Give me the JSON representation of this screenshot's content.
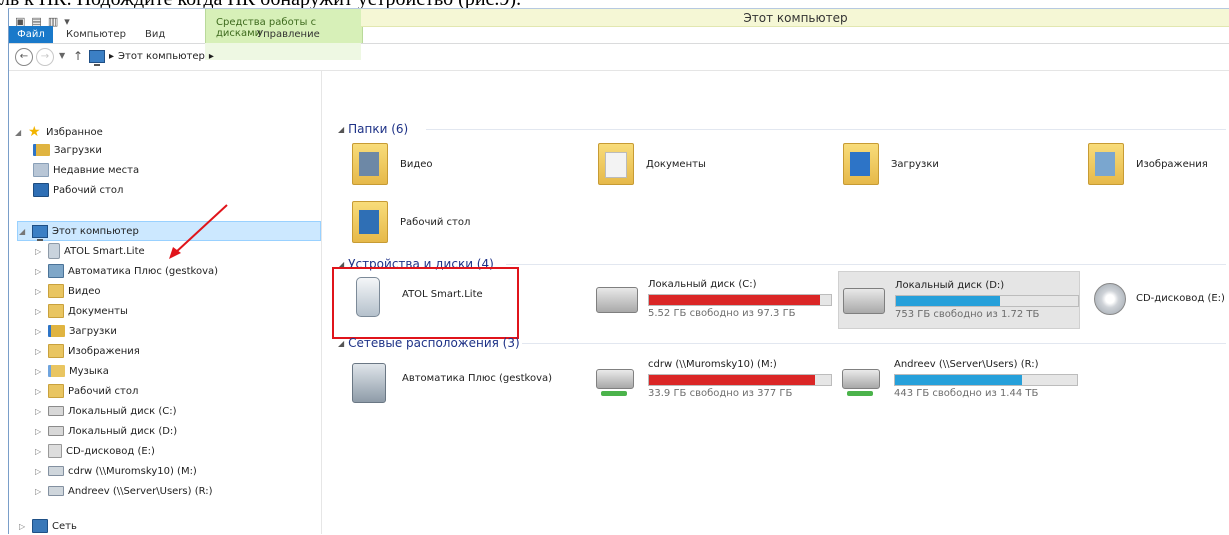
{
  "doc_fragment": "ль к ПК. Подождите когда ПК обнаружит устройство (рис.9).",
  "window": {
    "title": "Этот компьютер",
    "contextual_group": "Средства работы с дисками"
  },
  "ribbon": {
    "tabs": [
      "Файл",
      "Компьютер",
      "Вид",
      "Управление"
    ]
  },
  "address": {
    "path": [
      "Этот компьютер"
    ]
  },
  "navigation": {
    "favorites_label": "Избранное",
    "favorites": [
      {
        "label": "Загрузки",
        "icon": "downloads-folder-icon"
      },
      {
        "label": "Недавние места",
        "icon": "recent-places-icon"
      },
      {
        "label": "Рабочий стол",
        "icon": "desktop-icon"
      }
    ],
    "computer_label": "Этот компьютер",
    "computer_items": [
      {
        "label": "ATOL Smart.Lite",
        "icon": "phone-icon"
      },
      {
        "label": "Автоматика Плюс (gestkova)",
        "icon": "network-location-icon"
      },
      {
        "label": "Видео",
        "icon": "video-folder-icon"
      },
      {
        "label": "Документы",
        "icon": "documents-folder-icon"
      },
      {
        "label": "Загрузки",
        "icon": "downloads-folder-icon"
      },
      {
        "label": "Изображения",
        "icon": "pictures-folder-icon"
      },
      {
        "label": "Музыка",
        "icon": "music-folder-icon"
      },
      {
        "label": "Рабочий стол",
        "icon": "desktop-folder-icon"
      },
      {
        "label": "Локальный диск (C:)",
        "icon": "drive-icon"
      },
      {
        "label": "Локальный диск (D:)",
        "icon": "drive-icon"
      },
      {
        "label": "CD-дисковод (E:)",
        "icon": "cd-drive-icon"
      },
      {
        "label": "cdrw (\\\\Muromsky10) (M:)",
        "icon": "network-drive-icon"
      },
      {
        "label": "Andreev (\\\\Server\\Users) (R:)",
        "icon": "network-drive-icon"
      }
    ],
    "network_label": "Сеть"
  },
  "content": {
    "folders_header": "Папки (6)",
    "folders": [
      "Видео",
      "Документы",
      "Загрузки",
      "Изображения",
      "Рабочий стол"
    ],
    "devices_header": "Устройства и диски (4)",
    "devices": [
      {
        "name": "ATOL Smart.Lite",
        "kind": "portable-device"
      },
      {
        "name": "Локальный диск (C:)",
        "free": "5.52 ГБ свободно из 97.3 ГБ",
        "used_fraction": 0.94,
        "bar_color": "#da2626"
      },
      {
        "name": "Локальный диск (D:)",
        "free": "753 ГБ свободно из 1.72 ТБ",
        "used_fraction": 0.57,
        "bar_color": "#26a0da"
      },
      {
        "name": "CD-дисковод (E:)",
        "kind": "cd"
      }
    ],
    "network_header": "Сетевые расположения (3)",
    "network": [
      {
        "name": "Автоматика Плюс (gestkova)",
        "kind": "location"
      },
      {
        "name": "cdrw (\\\\Muromsky10) (M:)",
        "free": "33.9 ГБ свободно из 377 ГБ",
        "used_fraction": 0.91,
        "bar_color": "#da2626"
      },
      {
        "name": "Andreev (\\\\Server\\Users) (R:)",
        "free": "443 ГБ свободно из 1.44 ТБ",
        "used_fraction": 0.7,
        "bar_color": "#26a0da"
      }
    ]
  },
  "annotation_color": "#e0141b"
}
